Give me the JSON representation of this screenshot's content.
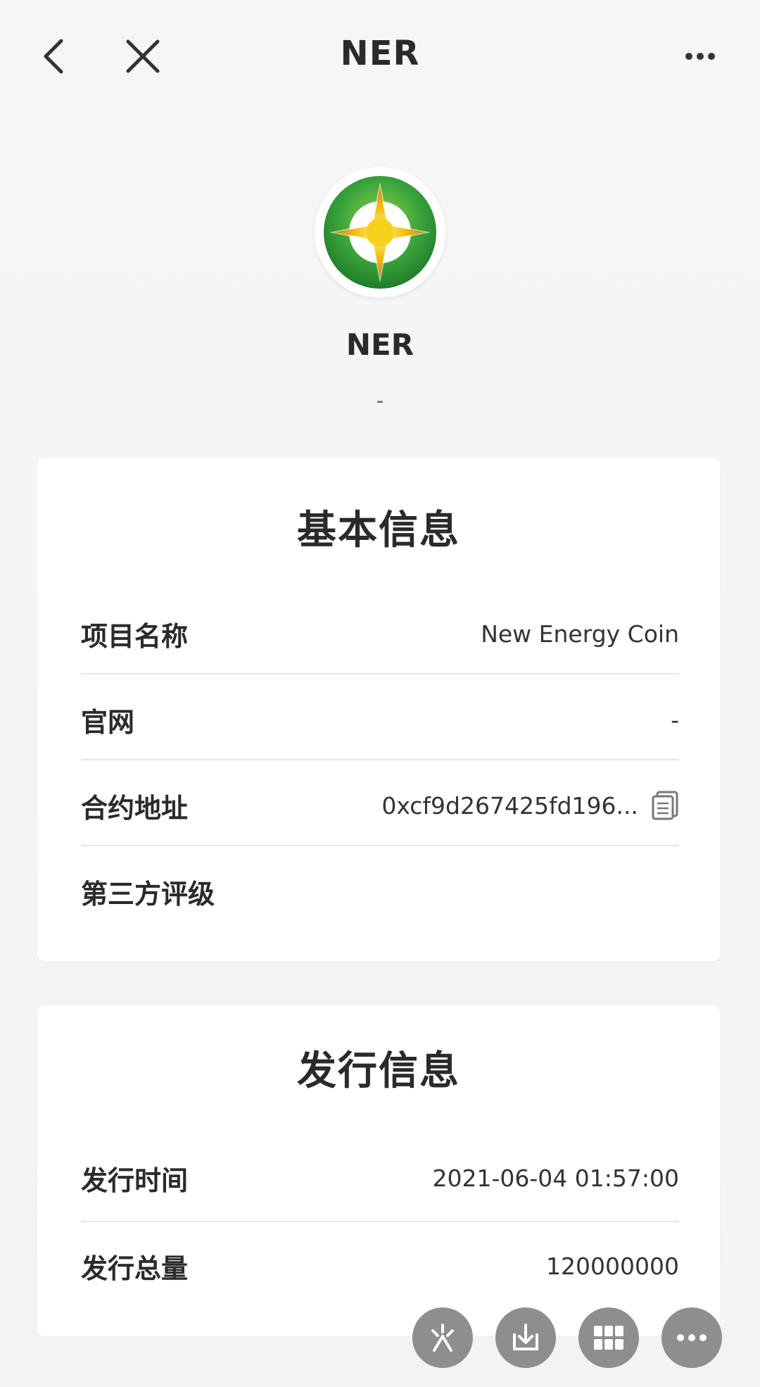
{
  "nav": {
    "title": "NER"
  },
  "coin": {
    "name": "NER",
    "subtitle": "-"
  },
  "basic_info": {
    "title": "基本信息",
    "rows": [
      {
        "label": "项目名称",
        "value": "New Energy Coin"
      },
      {
        "label": "官网",
        "value": "-"
      },
      {
        "label": "合约地址",
        "value": "0xcf9d267425fd196..."
      },
      {
        "label": "第三方评级",
        "value": ""
      }
    ]
  },
  "issue_info": {
    "title": "发行信息",
    "rows": [
      {
        "label": "发行时间",
        "value": "2021-06-04 01:57:00"
      },
      {
        "label": "发行总量",
        "value": "120000000"
      }
    ]
  },
  "icons": {
    "back": "back-arrow-icon",
    "close": "close-icon",
    "more": "more-dots-icon",
    "copy": "copy-icon",
    "fab1": "shake-icon",
    "fab2": "download-icon",
    "fab3": "grid-apps-icon",
    "fab4": "more-dots-icon"
  },
  "colors": {
    "background": "#f3f3f3",
    "card": "#ffffff",
    "fab": "#8e8e8e",
    "coin_green": "#3aa33a",
    "coin_yellow": "#f5c518"
  }
}
